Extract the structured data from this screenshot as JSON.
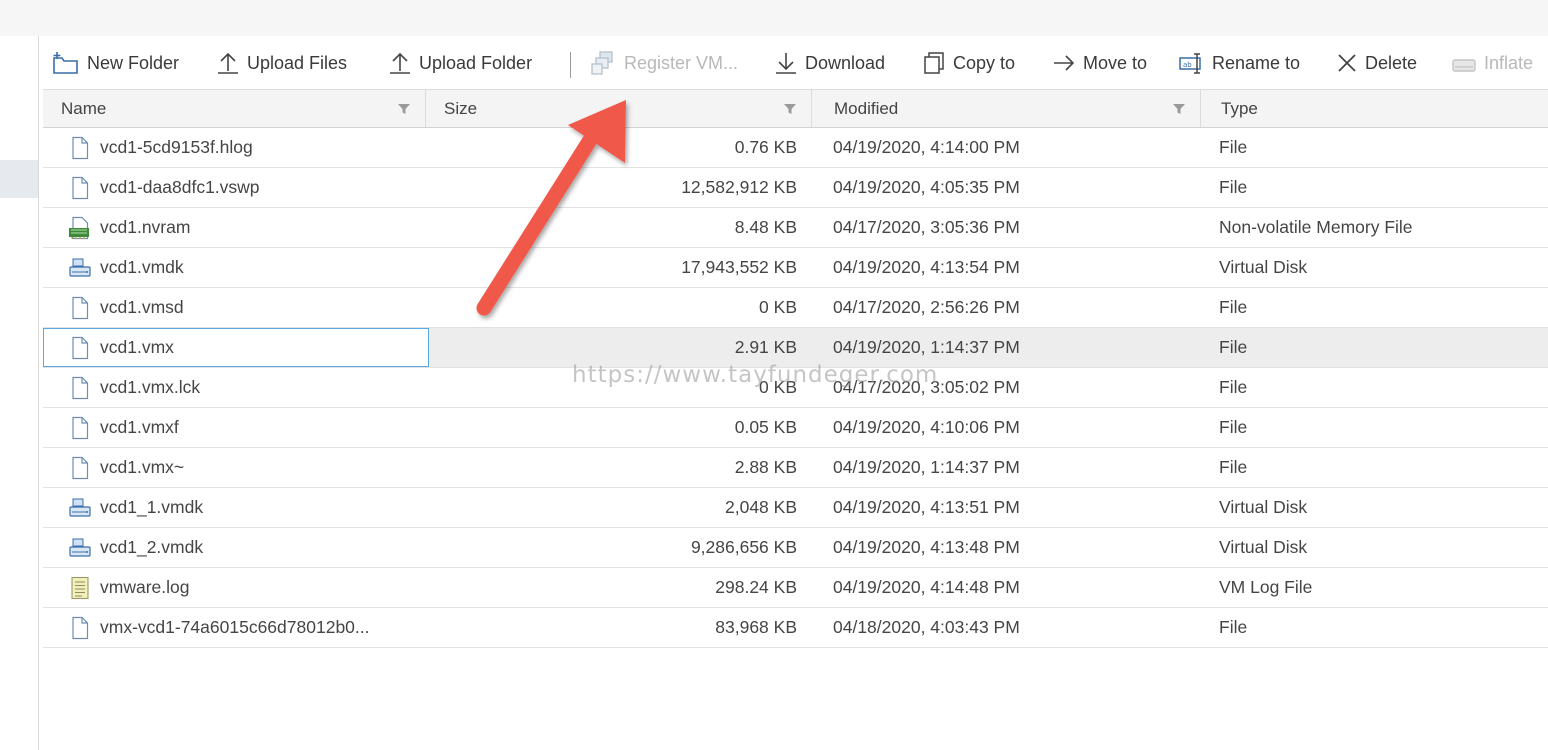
{
  "toolbar": {
    "new_folder": "New Folder",
    "upload_files": "Upload Files",
    "upload_folder": "Upload Folder",
    "register_vm": "Register VM...",
    "download": "Download",
    "copy_to": "Copy to",
    "move_to": "Move to",
    "rename_to": "Rename to",
    "delete": "Delete",
    "inflate": "Inflate"
  },
  "columns": {
    "name": "Name",
    "size": "Size",
    "modified": "Modified",
    "type": "Type"
  },
  "files": [
    {
      "name": "vcd1-5cd9153f.hlog",
      "size": "0.76 KB",
      "modified": "04/19/2020, 4:14:00 PM",
      "type": "File",
      "icon": "file-icon"
    },
    {
      "name": "vcd1-daa8dfc1.vswp",
      "size": "12,582,912 KB",
      "modified": "04/19/2020, 4:05:35 PM",
      "type": "File",
      "icon": "file-icon"
    },
    {
      "name": "vcd1.nvram",
      "size": "8.48 KB",
      "modified": "04/17/2020, 3:05:36 PM",
      "type": "Non-volatile Memory File",
      "icon": "nvram-icon"
    },
    {
      "name": "vcd1.vmdk",
      "size": "17,943,552 KB",
      "modified": "04/19/2020, 4:13:54 PM",
      "type": "Virtual Disk",
      "icon": "virtual-disk-icon"
    },
    {
      "name": "vcd1.vmsd",
      "size": "0 KB",
      "modified": "04/17/2020, 2:56:26 PM",
      "type": "File",
      "icon": "file-icon"
    },
    {
      "name": "vcd1.vmx",
      "size": "2.91 KB",
      "modified": "04/19/2020, 1:14:37 PM",
      "type": "File",
      "icon": "file-icon",
      "selected": true
    },
    {
      "name": "vcd1.vmx.lck",
      "size": "0 KB",
      "modified": "04/17/2020, 3:05:02 PM",
      "type": "File",
      "icon": "file-icon"
    },
    {
      "name": "vcd1.vmxf",
      "size": "0.05 KB",
      "modified": "04/19/2020, 4:10:06 PM",
      "type": "File",
      "icon": "file-icon"
    },
    {
      "name": "vcd1.vmx~",
      "size": "2.88 KB",
      "modified": "04/19/2020, 1:14:37 PM",
      "type": "File",
      "icon": "file-icon"
    },
    {
      "name": "vcd1_1.vmdk",
      "size": "2,048 KB",
      "modified": "04/19/2020, 4:13:51 PM",
      "type": "Virtual Disk",
      "icon": "virtual-disk-icon"
    },
    {
      "name": "vcd1_2.vmdk",
      "size": "9,286,656 KB",
      "modified": "04/19/2020, 4:13:48 PM",
      "type": "Virtual Disk",
      "icon": "virtual-disk-icon"
    },
    {
      "name": "vmware.log",
      "size": "298.24 KB",
      "modified": "04/19/2020, 4:14:48 PM",
      "type": "VM Log File",
      "icon": "log-file-icon"
    },
    {
      "name": "vmx-vcd1-74a6015c66d78012b0...",
      "size": "83,968 KB",
      "modified": "04/18/2020, 4:03:43 PM",
      "type": "File",
      "icon": "file-icon"
    }
  ],
  "watermark": "https://www.tayfundeger.com",
  "colors": {
    "arrow": "#f0584a",
    "selection_outline": "#5aa9e6",
    "header_bg": "#f4f4f4"
  }
}
